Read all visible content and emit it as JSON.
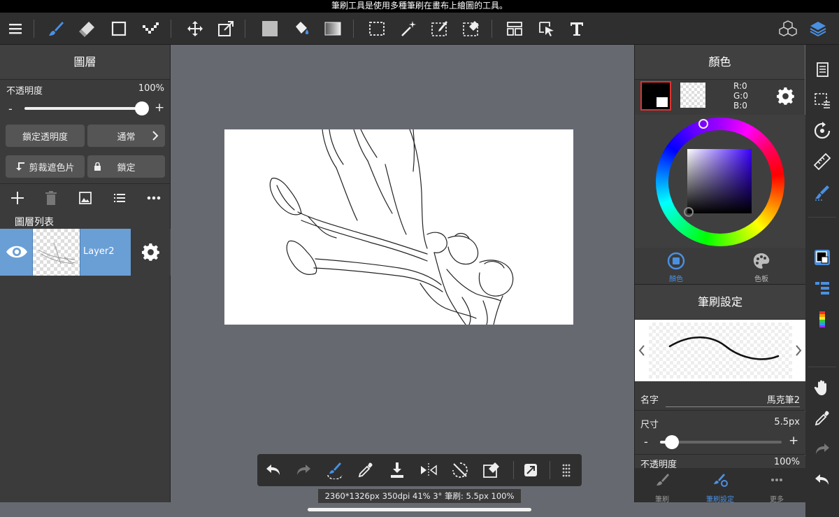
{
  "tip": "筆刷工具是使用多種筆刷在畫布上繪圖的工具。",
  "toolbar": {
    "icons": [
      "menu-icon",
      "brush-icon",
      "eraser-icon",
      "rectangle-icon",
      "dot-line-icon",
      "move-icon",
      "transform-icon",
      "fill-color-icon",
      "bucket-icon",
      "gradient-icon",
      "select-rect-icon",
      "magic-wand-icon",
      "select-pen-icon",
      "select-eraser-icon",
      "frame-layout-icon",
      "select-layer-icon",
      "text-icon",
      "3d-icon",
      "layers-icon"
    ]
  },
  "layers_panel": {
    "title": "圖層",
    "opacity_label": "不透明度",
    "opacity_value": "100%",
    "opacity_fraction": 1.0,
    "minus": "-",
    "plus": "+",
    "lock_alpha": "鎖定透明度",
    "blend_mode": "通常",
    "clip": "剪裁遮色片",
    "lock": "鎖定",
    "list_title": "圖層列表",
    "layer_name": "Layer2"
  },
  "color_panel": {
    "title": "顏色",
    "rgb": {
      "r": "R:0",
      "g": "G:0",
      "b": "B:0"
    },
    "tab_color": "顏色",
    "tab_palette": "色板",
    "primary_color": "#000000",
    "accent": "#4a90e2"
  },
  "brush_panel": {
    "title": "筆刷設定",
    "name_label": "名字",
    "name_value": "馬克筆2",
    "size_label": "尺寸",
    "size_value": "5.5px",
    "size_fraction": 0.1,
    "opacity_label": "不透明度",
    "opacity_value": "100%",
    "minus": "-",
    "plus": "+",
    "tab_brush": "筆刷",
    "tab_settings": "筆刷設定",
    "tab_more": "更多"
  },
  "status": "2360*1326px 350dpi 41% 3° 筆刷: 5.5px 100%"
}
